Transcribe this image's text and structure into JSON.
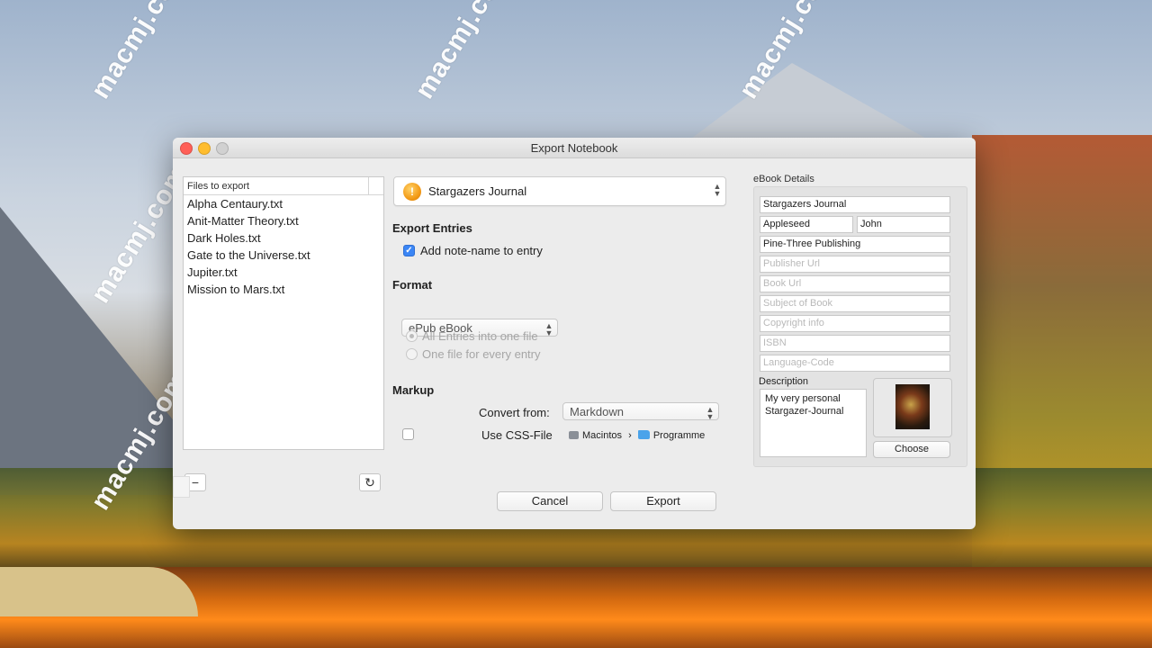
{
  "watermark": {
    "text": "macmj.com"
  },
  "window": {
    "title": "Export Notebook"
  },
  "files": {
    "header": "Files to export",
    "items": [
      "Alpha Centaury.txt",
      "Anit-Matter Theory.txt",
      "Dark Holes.txt",
      "Gate to the Universe.txt",
      "Jupiter.txt",
      "Mission to Mars.txt"
    ],
    "remove_label": "−",
    "refresh_label": "↻"
  },
  "notebook": {
    "selected": "Stargazers Journal",
    "icon_glyph": "!"
  },
  "export_entries": {
    "title": "Export Entries",
    "add_note_name_label": "Add note-name to entry",
    "add_note_name_checked": true
  },
  "format": {
    "title": "Format",
    "selected": "ePub eBook",
    "radio_all": "All Entries into one file",
    "radio_each": "One file for every entry"
  },
  "markup": {
    "title": "Markup",
    "convert_from_label": "Convert from:",
    "convert_from_value": "Markdown",
    "use_css_label": "Use CSS-File",
    "path_drive": "Macintos",
    "path_folder": "Programme",
    "path_separator": "›"
  },
  "ebook": {
    "title": "eBook Details",
    "book_title": "Stargazers Journal",
    "author_last": "Appleseed",
    "author_first": "John",
    "publisher": "Pine-Three Publishing",
    "placeholders": {
      "publisher_url": "Publisher Url",
      "book_url": "Book Url",
      "subject": "Subject of Book",
      "copyright": "Copyright info",
      "isbn": "ISBN",
      "language": "Language-Code"
    },
    "description_label": "Description",
    "description_line1": "My very personal",
    "description_line2": "Stargazer-Journal",
    "choose_label": "Choose"
  },
  "buttons": {
    "cancel": "Cancel",
    "export": "Export"
  }
}
